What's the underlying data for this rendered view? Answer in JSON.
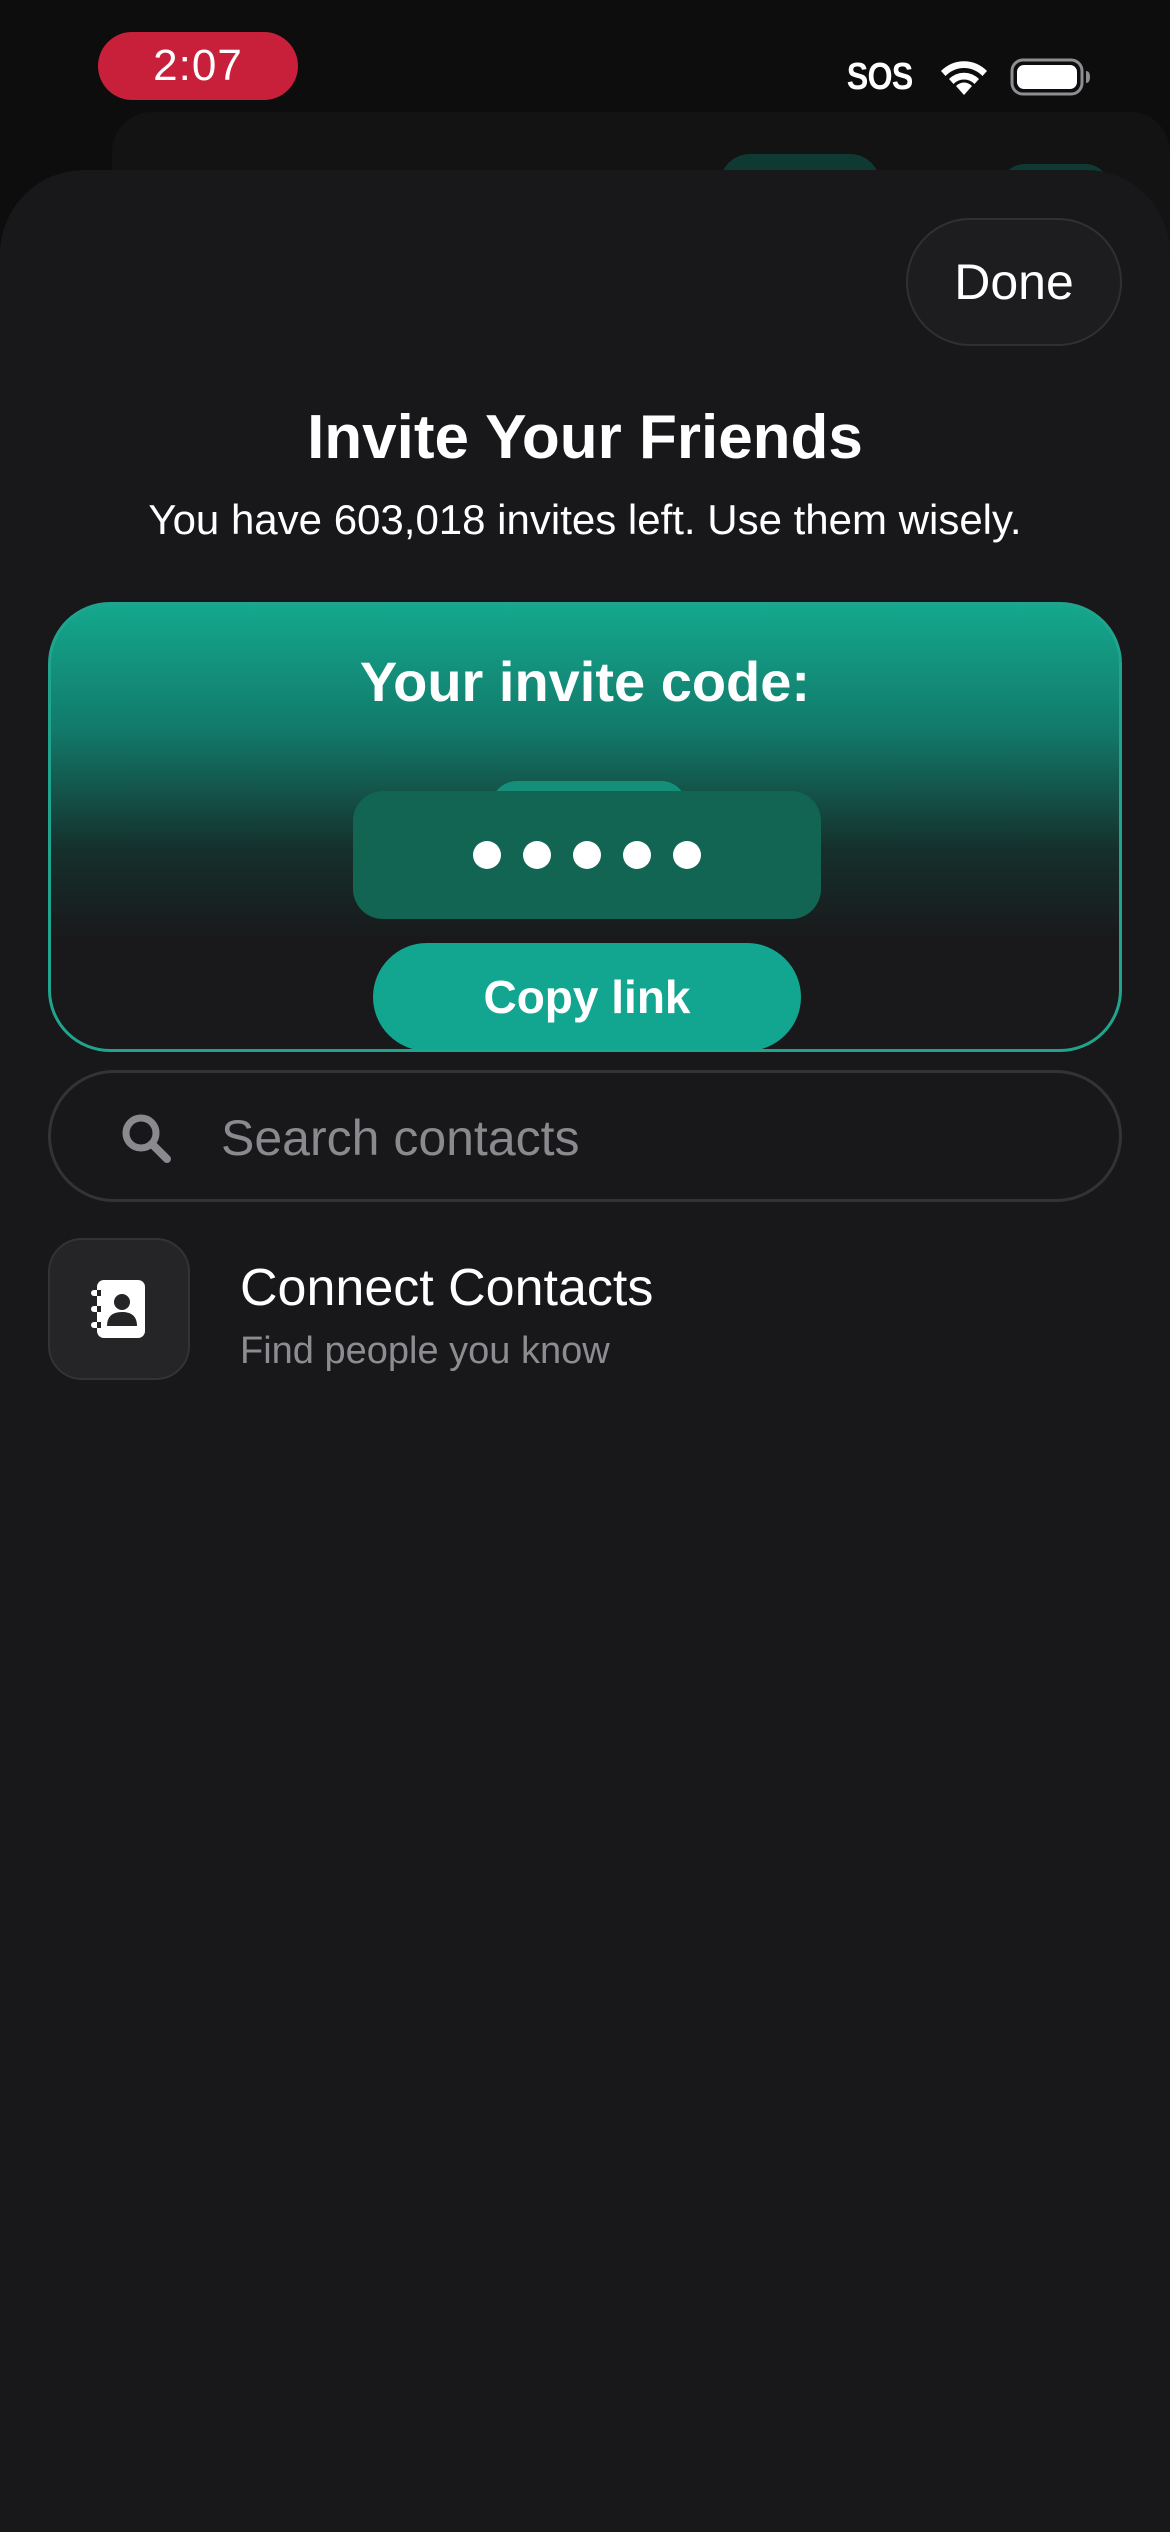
{
  "status_bar": {
    "time": "2:07",
    "sos": "SOS",
    "wifi_icon": "wifi-icon",
    "battery_icon": "battery-icon",
    "time_pill_color": "#c8203a"
  },
  "sheet": {
    "done_label": "Done",
    "title": "Invite Your Friends",
    "subtitle": "You have 603,018 invites left. Use them wisely."
  },
  "invite_card": {
    "label": "Your invite code:",
    "code_masked": "•••••",
    "copy_label": "Copy link",
    "accent_color": "#12a690"
  },
  "search": {
    "placeholder": "Search contacts",
    "value": "",
    "icon": "search-icon"
  },
  "contacts_row": {
    "title": "Connect Contacts",
    "subtitle": "Find people you know",
    "icon": "contact-book-icon"
  }
}
